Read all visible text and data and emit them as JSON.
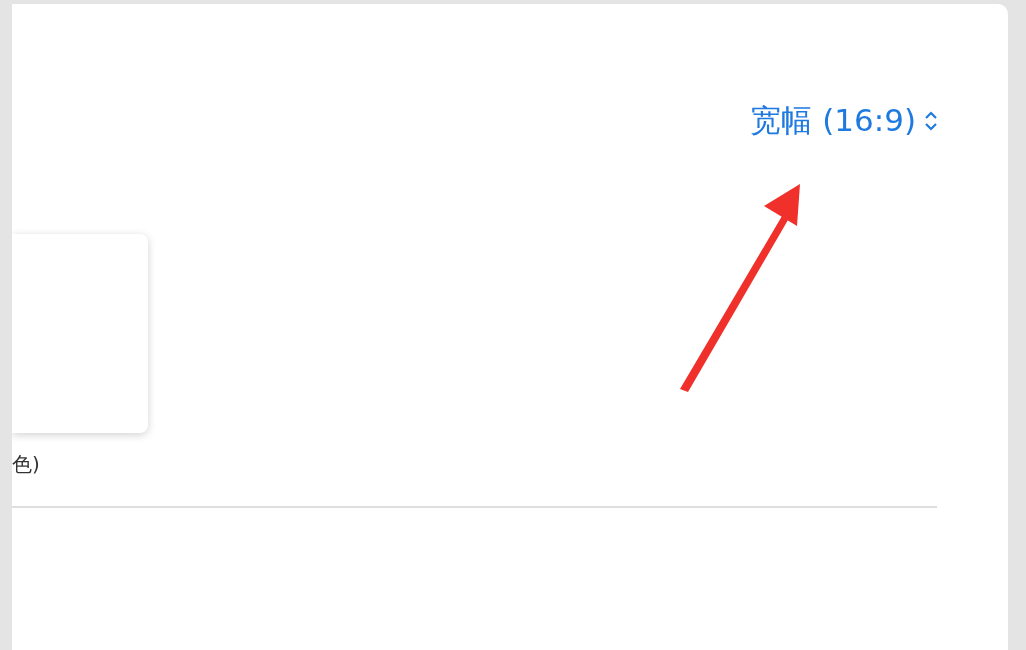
{
  "size_popup": {
    "label": "宽幅 (16:9)"
  },
  "theme_card": {
    "caption": "色)"
  },
  "annotation": {
    "kind": "arrow"
  }
}
